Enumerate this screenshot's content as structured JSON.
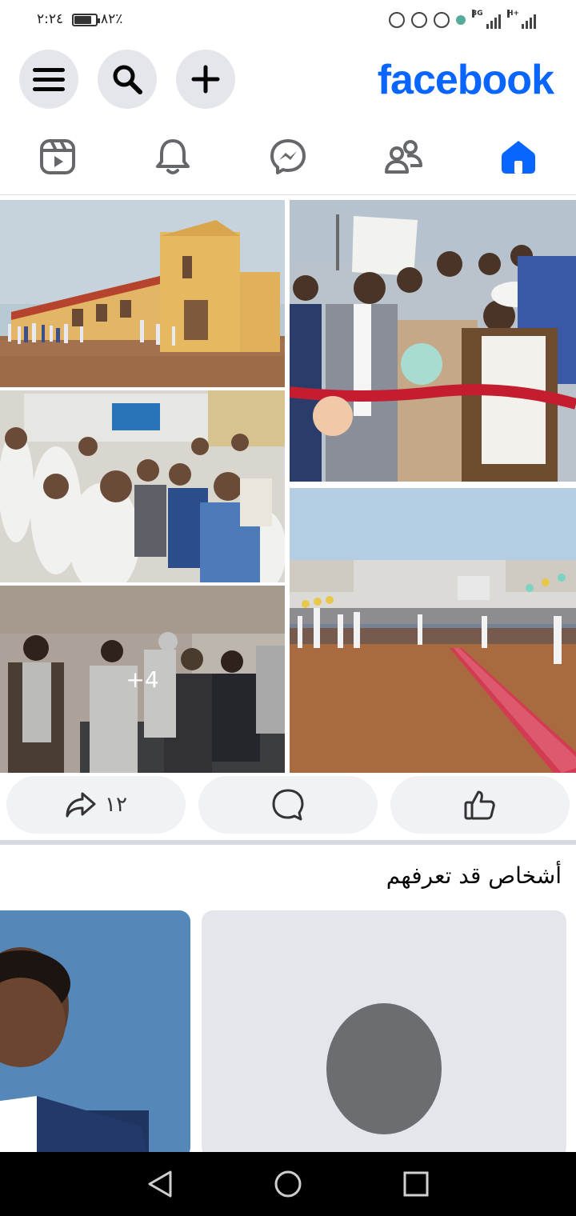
{
  "status_bar": {
    "time": "٢:٢٤",
    "battery_percent": "٨٢٪",
    "battery_level": 0.82,
    "network_1": "3G",
    "network_2": "H+"
  },
  "header": {
    "logo": "facebook",
    "brand_color": "#0866ff",
    "menu_icon": "hamburger-icon",
    "search_icon": "search-icon",
    "create_icon": "plus-icon"
  },
  "nav": {
    "items": [
      {
        "icon": "reels-icon"
      },
      {
        "icon": "bell-icon"
      },
      {
        "icon": "messenger-icon"
      },
      {
        "icon": "friends-icon"
      },
      {
        "icon": "home-icon",
        "active": true
      }
    ],
    "active_color": "#0866ff"
  },
  "post": {
    "more_photos": "+4",
    "share_count": "١٢"
  },
  "pymk": {
    "title": "أشخاص قد تعرفهم"
  },
  "system_nav": {
    "back_icon": "back-triangle-icon",
    "home_icon": "home-circle-icon",
    "recents_icon": "recents-square-icon"
  }
}
